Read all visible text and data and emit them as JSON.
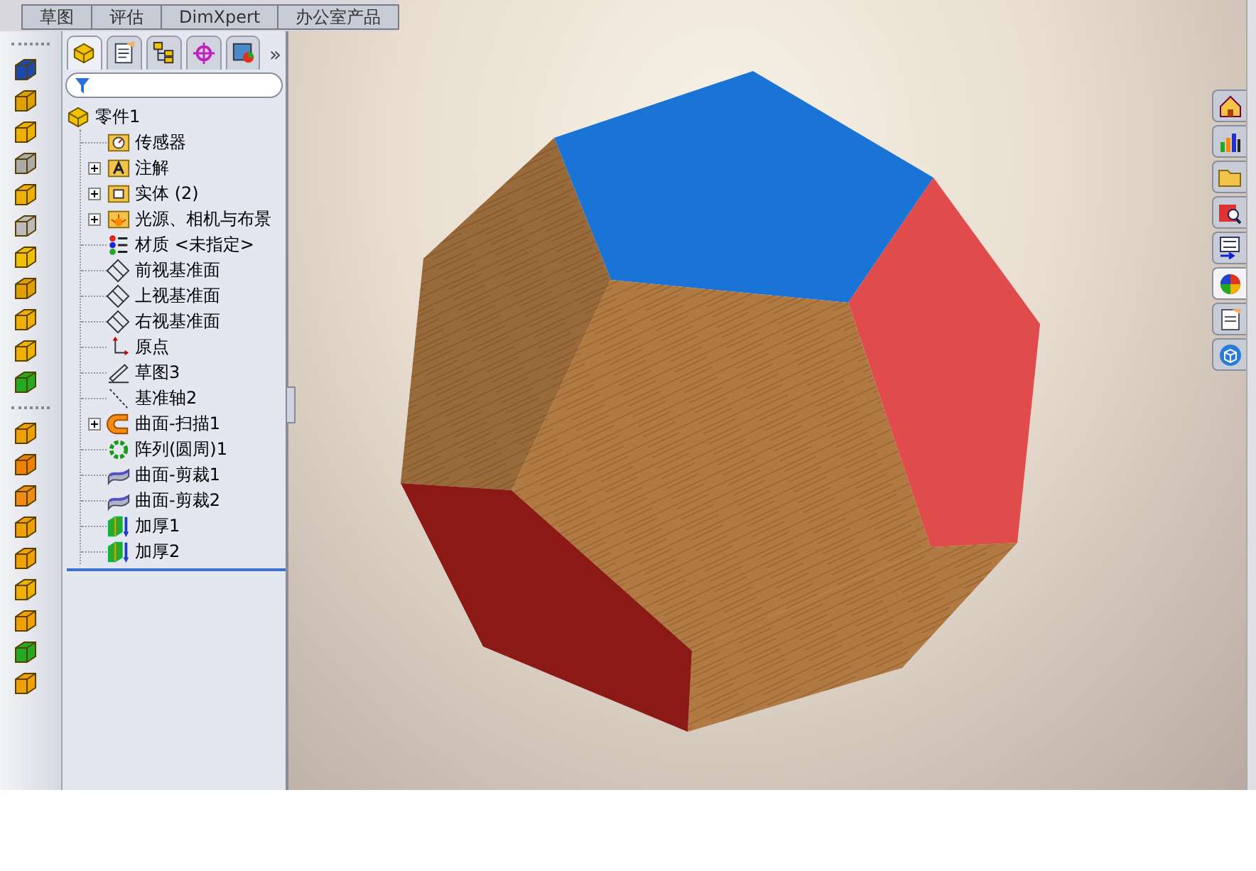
{
  "command_tabs": [
    {
      "label": "草图",
      "selected": false
    },
    {
      "label": "评估",
      "selected": false
    },
    {
      "label": "DimXpert",
      "selected": false
    },
    {
      "label": "办公室产品",
      "selected": false
    }
  ],
  "panel_tabs": [
    {
      "kind": "part",
      "selected": true
    },
    {
      "kind": "property",
      "selected": false
    },
    {
      "kind": "config",
      "selected": false
    },
    {
      "kind": "target",
      "selected": false
    },
    {
      "kind": "display",
      "selected": false
    }
  ],
  "panel_more": "»",
  "feature_tree": {
    "label": "零件1",
    "kind": "part",
    "children": [
      {
        "label": "传感器",
        "kind": "sensor"
      },
      {
        "label": "注解",
        "kind": "annotation",
        "expanded": false
      },
      {
        "label": "实体 (2)",
        "kind": "solid",
        "expanded": false
      },
      {
        "label": "光源、相机与布景",
        "kind": "lights",
        "expanded": false
      },
      {
        "label": "材质 <未指定>",
        "kind": "material"
      },
      {
        "label": "前视基准面",
        "kind": "plane"
      },
      {
        "label": "上视基准面",
        "kind": "plane"
      },
      {
        "label": "右视基准面",
        "kind": "plane"
      },
      {
        "label": "原点",
        "kind": "origin"
      },
      {
        "label": "草图3",
        "kind": "sketch"
      },
      {
        "label": "基准轴2",
        "kind": "axis"
      },
      {
        "label": "曲面-扫描1",
        "kind": "sweep",
        "expanded": false
      },
      {
        "label": "阵列(圆周)1",
        "kind": "pattern"
      },
      {
        "label": "曲面-剪裁1",
        "kind": "trim"
      },
      {
        "label": "曲面-剪裁2",
        "kind": "trim"
      },
      {
        "label": "加厚1",
        "kind": "thicken"
      },
      {
        "label": "加厚2",
        "kind": "thicken"
      }
    ]
  },
  "task_pane": [
    {
      "kind": "home",
      "selected": false
    },
    {
      "kind": "chart",
      "selected": false
    },
    {
      "kind": "folder",
      "selected": false
    },
    {
      "kind": "search",
      "selected": false
    },
    {
      "kind": "list",
      "selected": false
    },
    {
      "kind": "ball",
      "selected": true
    },
    {
      "kind": "doc",
      "selected": false
    },
    {
      "kind": "threed",
      "selected": false
    }
  ]
}
